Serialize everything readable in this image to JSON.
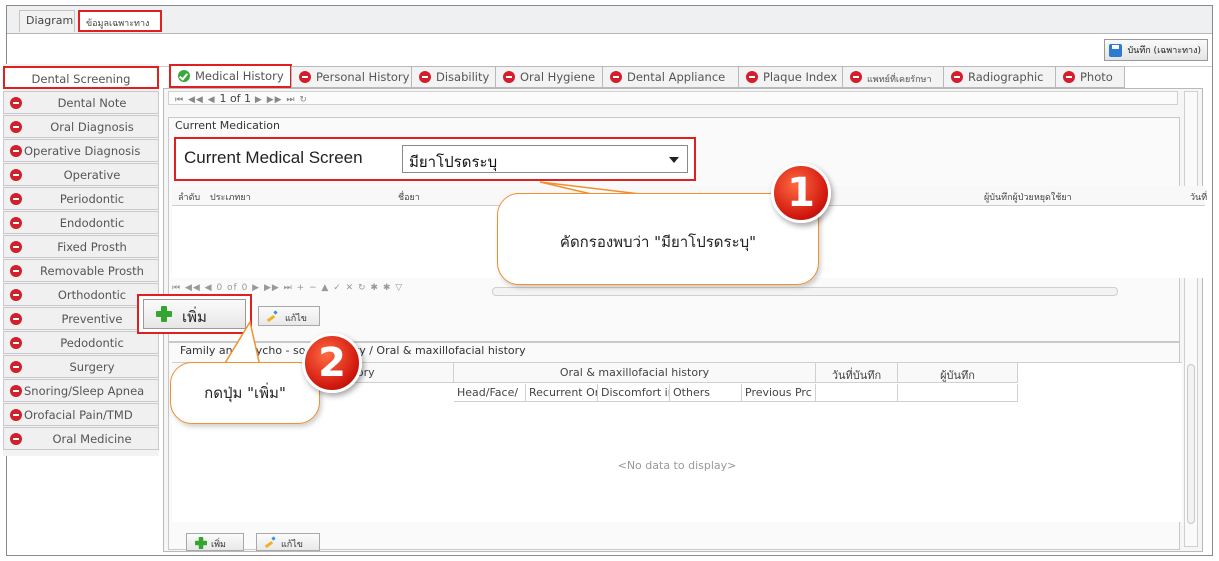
{
  "top_tabs": [
    "Diagram",
    "ข้อมูลเฉพาะทาง"
  ],
  "toolbar": {
    "save_label": "บันทึก (เฉพาะทาง)"
  },
  "sidebar": {
    "items": [
      {
        "label": "Dental Screening",
        "active": true
      },
      {
        "label": "Dental Note"
      },
      {
        "label": "Oral Diagnosis"
      },
      {
        "label": "Operative Diagnosis"
      },
      {
        "label": "Operative"
      },
      {
        "label": "Periodontic"
      },
      {
        "label": "Endodontic"
      },
      {
        "label": "Fixed Prosth"
      },
      {
        "label": "Removable Prosth"
      },
      {
        "label": "Orthodontic"
      },
      {
        "label": "Preventive"
      },
      {
        "label": "Pedodontic"
      },
      {
        "label": "Surgery"
      },
      {
        "label": "Snoring/Sleep Apnea"
      },
      {
        "label": "Orofacial Pain/TMD"
      },
      {
        "label": "Oral Medicine"
      }
    ]
  },
  "subtabs": [
    "Medical History",
    "Personal History",
    "Disability",
    "Oral Hygiene",
    "Dental Appliance",
    "Plaque Index",
    "แพทย์ที่เคยรักษา",
    "Radiographic",
    "Photo"
  ],
  "navbar": {
    "page_text": "1 of 1"
  },
  "current_medication": {
    "title": "Current Medication",
    "filter_label": "Current Medical Screen",
    "filter_value": "มียาโปรดระบุ",
    "columns": [
      "ลำดับ",
      "ประเภทยา",
      "ชื่อยา",
      "ผู้บันทึกผู้ป่วยหยุดใช้ยา",
      "วันที่"
    ],
    "pager_text": "0 of 0"
  },
  "buttons": {
    "add": "เพิ่ม",
    "edit": "แก้ไข"
  },
  "family": {
    "title": "Family and psycho - social history / Oral & maxillofacial history",
    "group_social": "social history",
    "group_oral": "Oral & maxillofacial history",
    "col_saved_date": "วันที่บันทึก",
    "col_saved_by": "ผู้บันทึก",
    "sub_columns": [
      "Head/Face/",
      "Recurrent Or",
      "Discomfort ir",
      "Others",
      "Previous Prc"
    ],
    "empty_text": "<No data to display>"
  },
  "callouts": [
    {
      "number": "1",
      "text": "คัดกรองพบว่า \"มียาโปรดระบุ\""
    },
    {
      "number": "2",
      "text": "กดปุ่ม \"เพิ่ม\""
    }
  ]
}
